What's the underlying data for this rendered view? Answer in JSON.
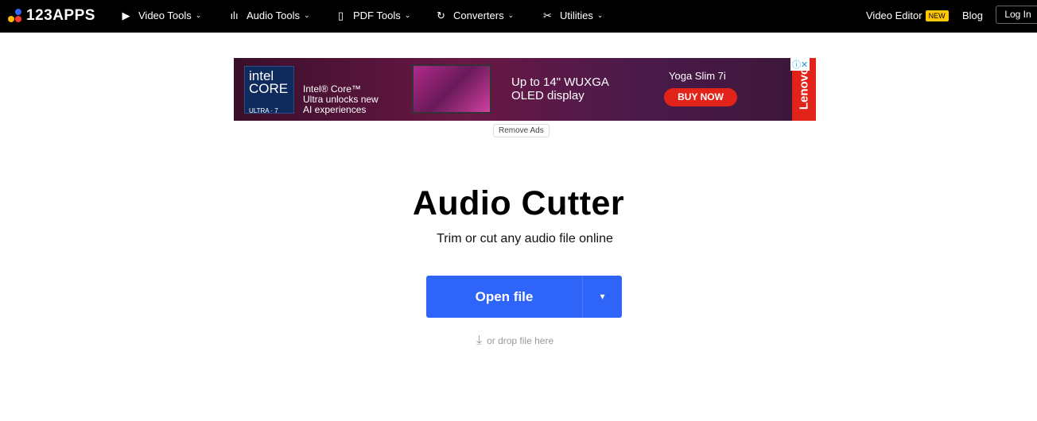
{
  "nav": {
    "logo": "123APPS",
    "items": [
      {
        "label": "Video Tools",
        "icon": "play-icon"
      },
      {
        "label": "Audio Tools",
        "icon": "waveform-icon"
      },
      {
        "label": "PDF Tools",
        "icon": "document-icon"
      },
      {
        "label": "Converters",
        "icon": "convert-icon"
      },
      {
        "label": "Utilities",
        "icon": "tools-icon"
      }
    ],
    "video_editor": "Video Editor",
    "new_badge": "NEW",
    "blog": "Blog",
    "login": "Log In"
  },
  "ad": {
    "intel_logo": "intel CORE ULTRA 7",
    "text1": "Intel® Core™",
    "text2": "Ultra unlocks new",
    "text3": "AI experiences",
    "headline1": "Up to 14\" WUXGA",
    "headline2": "OLED display",
    "product": "Yoga Slim 7i",
    "cta": "BUY NOW",
    "brand": "Lenovo",
    "remove_ads": "Remove Ads"
  },
  "main": {
    "title": "Audio Cutter",
    "subtitle": "Trim or cut any audio file online",
    "open_file": "Open file",
    "drop_hint": "or drop file here"
  },
  "colors": {
    "accent": "#2e65f8",
    "badge": "#ffc800"
  }
}
